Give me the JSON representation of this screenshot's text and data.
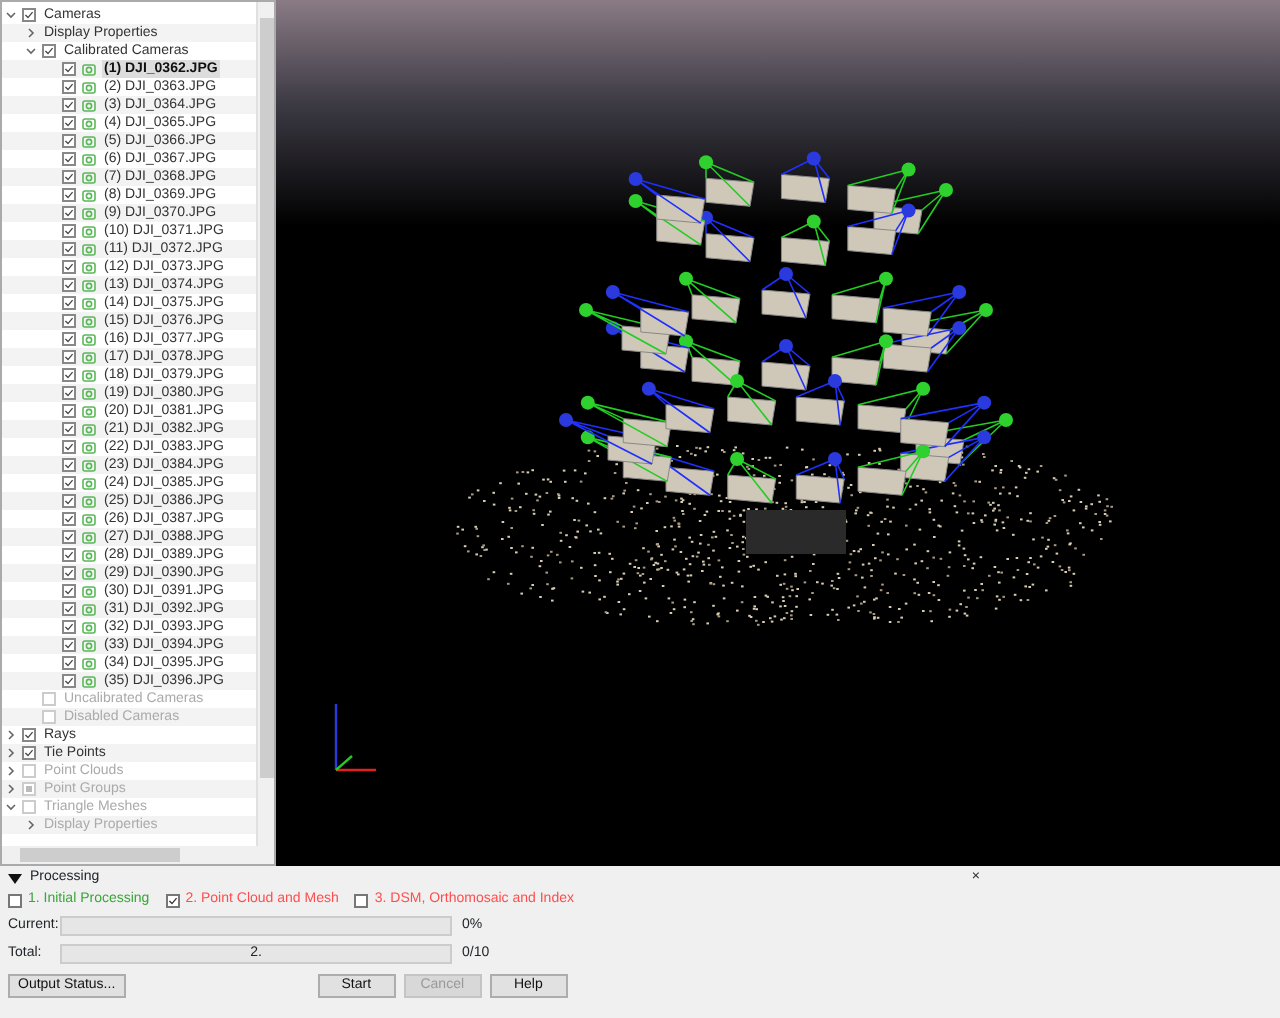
{
  "tree": [
    {
      "label": "Cameras",
      "kind": "group",
      "checked": true,
      "expanded": true,
      "disabled": false,
      "selected": false,
      "children": [
        {
          "label": "Display Properties",
          "kind": "folder",
          "expanded": false,
          "disabled": false,
          "selected": false
        },
        {
          "label": "Calibrated Cameras",
          "kind": "group",
          "checked": true,
          "expanded": true,
          "disabled": false,
          "selected": false,
          "children": [
            {
              "label": "(1) DJI_0362.JPG",
              "kind": "camera",
              "checked": true,
              "disabled": false,
              "selected": true
            },
            {
              "label": "(2) DJI_0363.JPG",
              "kind": "camera",
              "checked": true,
              "disabled": false,
              "selected": false
            },
            {
              "label": "(3) DJI_0364.JPG",
              "kind": "camera",
              "checked": true,
              "disabled": false,
              "selected": false
            },
            {
              "label": "(4) DJI_0365.JPG",
              "kind": "camera",
              "checked": true,
              "disabled": false,
              "selected": false
            },
            {
              "label": "(5) DJI_0366.JPG",
              "kind": "camera",
              "checked": true,
              "disabled": false,
              "selected": false
            },
            {
              "label": "(6) DJI_0367.JPG",
              "kind": "camera",
              "checked": true,
              "disabled": false,
              "selected": false
            },
            {
              "label": "(7) DJI_0368.JPG",
              "kind": "camera",
              "checked": true,
              "disabled": false,
              "selected": false
            },
            {
              "label": "(8) DJI_0369.JPG",
              "kind": "camera",
              "checked": true,
              "disabled": false,
              "selected": false
            },
            {
              "label": "(9) DJI_0370.JPG",
              "kind": "camera",
              "checked": true,
              "disabled": false,
              "selected": false
            },
            {
              "label": "(10) DJI_0371.JPG",
              "kind": "camera",
              "checked": true,
              "disabled": false,
              "selected": false
            },
            {
              "label": "(11) DJI_0372.JPG",
              "kind": "camera",
              "checked": true,
              "disabled": false,
              "selected": false
            },
            {
              "label": "(12) DJI_0373.JPG",
              "kind": "camera",
              "checked": true,
              "disabled": false,
              "selected": false
            },
            {
              "label": "(13) DJI_0374.JPG",
              "kind": "camera",
              "checked": true,
              "disabled": false,
              "selected": false
            },
            {
              "label": "(14) DJI_0375.JPG",
              "kind": "camera",
              "checked": true,
              "disabled": false,
              "selected": false
            },
            {
              "label": "(15) DJI_0376.JPG",
              "kind": "camera",
              "checked": true,
              "disabled": false,
              "selected": false
            },
            {
              "label": "(16) DJI_0377.JPG",
              "kind": "camera",
              "checked": true,
              "disabled": false,
              "selected": false
            },
            {
              "label": "(17) DJI_0378.JPG",
              "kind": "camera",
              "checked": true,
              "disabled": false,
              "selected": false
            },
            {
              "label": "(18) DJI_0379.JPG",
              "kind": "camera",
              "checked": true,
              "disabled": false,
              "selected": false
            },
            {
              "label": "(19) DJI_0380.JPG",
              "kind": "camera",
              "checked": true,
              "disabled": false,
              "selected": false
            },
            {
              "label": "(20) DJI_0381.JPG",
              "kind": "camera",
              "checked": true,
              "disabled": false,
              "selected": false
            },
            {
              "label": "(21) DJI_0382.JPG",
              "kind": "camera",
              "checked": true,
              "disabled": false,
              "selected": false
            },
            {
              "label": "(22) DJI_0383.JPG",
              "kind": "camera",
              "checked": true,
              "disabled": false,
              "selected": false
            },
            {
              "label": "(23) DJI_0384.JPG",
              "kind": "camera",
              "checked": true,
              "disabled": false,
              "selected": false
            },
            {
              "label": "(24) DJI_0385.JPG",
              "kind": "camera",
              "checked": true,
              "disabled": false,
              "selected": false
            },
            {
              "label": "(25) DJI_0386.JPG",
              "kind": "camera",
              "checked": true,
              "disabled": false,
              "selected": false
            },
            {
              "label": "(26) DJI_0387.JPG",
              "kind": "camera",
              "checked": true,
              "disabled": false,
              "selected": false
            },
            {
              "label": "(27) DJI_0388.JPG",
              "kind": "camera",
              "checked": true,
              "disabled": false,
              "selected": false
            },
            {
              "label": "(28) DJI_0389.JPG",
              "kind": "camera",
              "checked": true,
              "disabled": false,
              "selected": false
            },
            {
              "label": "(29) DJI_0390.JPG",
              "kind": "camera",
              "checked": true,
              "disabled": false,
              "selected": false
            },
            {
              "label": "(30) DJI_0391.JPG",
              "kind": "camera",
              "checked": true,
              "disabled": false,
              "selected": false
            },
            {
              "label": "(31) DJI_0392.JPG",
              "kind": "camera",
              "checked": true,
              "disabled": false,
              "selected": false
            },
            {
              "label": "(32) DJI_0393.JPG",
              "kind": "camera",
              "checked": true,
              "disabled": false,
              "selected": false
            },
            {
              "label": "(33) DJI_0394.JPG",
              "kind": "camera",
              "checked": true,
              "disabled": false,
              "selected": false
            },
            {
              "label": "(34) DJI_0395.JPG",
              "kind": "camera",
              "checked": true,
              "disabled": false,
              "selected": false
            },
            {
              "label": "(35) DJI_0396.JPG",
              "kind": "camera",
              "checked": true,
              "disabled": false,
              "selected": false
            }
          ]
        },
        {
          "label": "Uncalibrated Cameras",
          "kind": "leaf",
          "checked": false,
          "disabled": true,
          "selected": false
        },
        {
          "label": "Disabled Cameras",
          "kind": "leaf",
          "checked": false,
          "disabled": true,
          "selected": false
        }
      ]
    },
    {
      "label": "Rays",
      "kind": "group",
      "checked": true,
      "expanded": false,
      "disabled": false,
      "selected": false
    },
    {
      "label": "Tie Points",
      "kind": "group",
      "checked": true,
      "expanded": false,
      "disabled": false,
      "selected": false
    },
    {
      "label": "Point Clouds",
      "kind": "group",
      "checked": false,
      "expanded": false,
      "disabled": true,
      "selected": false
    },
    {
      "label": "Point Groups",
      "kind": "group",
      "partial": true,
      "expanded": false,
      "disabled": true,
      "selected": false
    },
    {
      "label": "Triangle Meshes",
      "kind": "group",
      "checked": false,
      "expanded": true,
      "disabled": true,
      "selected": false,
      "children": [
        {
          "label": "Display Properties",
          "kind": "folder",
          "expanded": false,
          "disabled": true,
          "selected": false
        }
      ]
    }
  ],
  "processing": {
    "title": "Processing",
    "close": "×",
    "steps": [
      {
        "label": "1. Initial Processing",
        "checked": false,
        "color": "#3aa53a"
      },
      {
        "label": "2. Point Cloud and Mesh",
        "checked": true,
        "color": "#ff4d4d"
      },
      {
        "label": "3. DSM, Orthomosaic and Index",
        "checked": false,
        "color": "#ff4d4d"
      }
    ],
    "progress": [
      {
        "label": "Current:",
        "level": 0,
        "reading": "0%"
      },
      {
        "label": "Total:",
        "text": "2.",
        "level": 0,
        "reading": "0/10"
      }
    ],
    "buttons": [
      {
        "label": "Output Status...",
        "disabled": false,
        "kind": "left"
      },
      {
        "label": "Start",
        "disabled": false,
        "kind": "right"
      },
      {
        "label": "Cancel",
        "disabled": true,
        "kind": "right"
      },
      {
        "label": "Help",
        "disabled": false,
        "kind": "right"
      }
    ]
  }
}
